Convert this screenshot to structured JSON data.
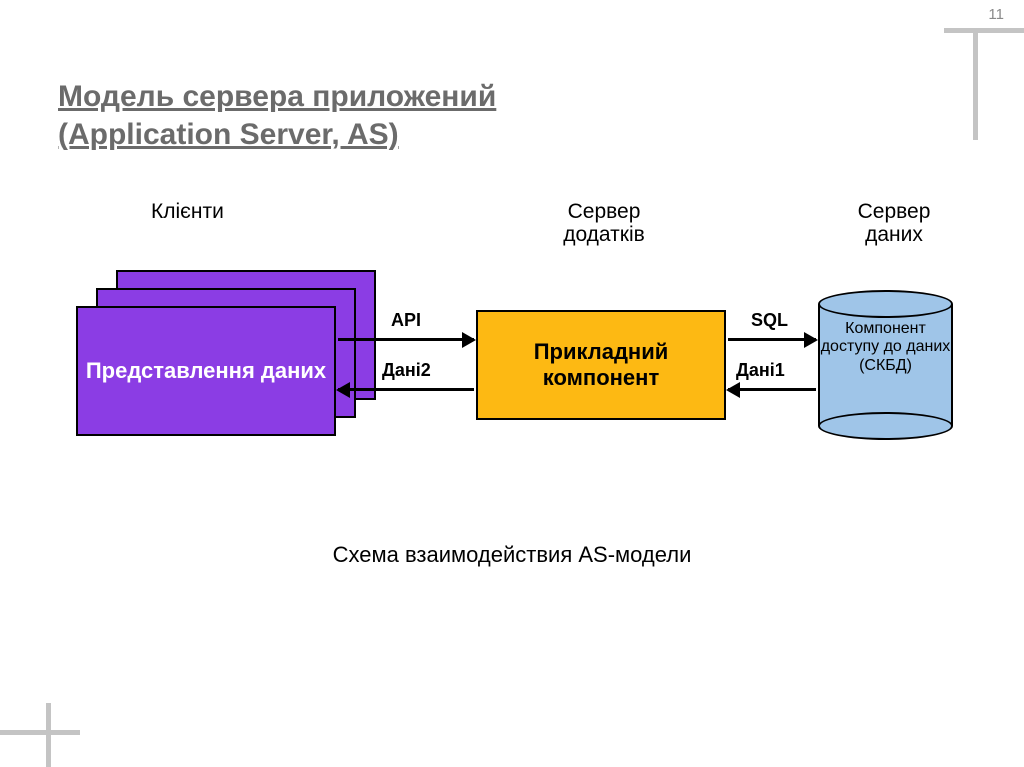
{
  "page_number": "11",
  "title_line1": "Модель сервера приложений",
  "title_line2": "(Application Server, AS)",
  "caption": "Схема взаимодействия AS-модели",
  "diagram": {
    "clients_label": "Клієнти",
    "appserver_label": "Сервер додатків",
    "dbserver_label": "Сервер даних",
    "client_box": "Представлення даних",
    "app_box": "Прикладний компонент",
    "db_cylinder": "Компонент доступу до даних (СКБД)",
    "arrows": {
      "api": "API",
      "dani2": "Дані2",
      "sql": "SQL",
      "dani1": "Дані1"
    }
  }
}
